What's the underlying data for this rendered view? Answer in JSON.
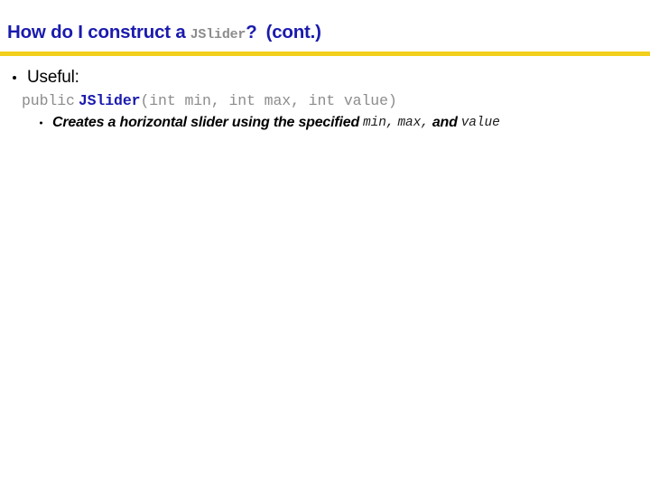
{
  "slide": {
    "title": {
      "part1": "How do I construct a",
      "code": "JSlider",
      "part2": "?",
      "part3": "(cont.)"
    },
    "accent_color": "#f2cf1b",
    "title_color": "#1a1aae",
    "code_gray": "#8c8c8c",
    "rule_name": "gold-divider",
    "content": {
      "bullet1": "Useful:",
      "signature": {
        "modifier": "public",
        "classname": "JSlider",
        "params": "(int min, int max, int value)"
      },
      "subbullet": {
        "text_a": "Creates a horizontal slider using the specified",
        "code_a": "min,",
        "code_b": "max,",
        "text_b": "and",
        "code_c": "value"
      }
    }
  }
}
